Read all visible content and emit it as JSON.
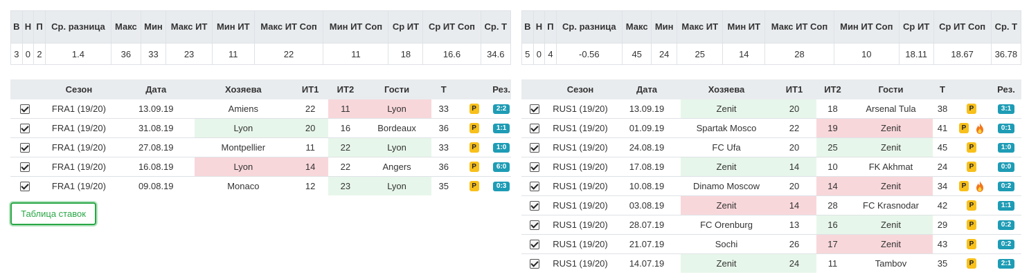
{
  "stats_headers": [
    "В",
    "Н",
    "П",
    "Ср. разница",
    "Макс",
    "Мин",
    "Макс ИТ",
    "Мин ИТ",
    "Макс ИТ Соп",
    "Мин ИТ Соп",
    "Ср ИТ",
    "Ср ИТ Соп",
    "Ср. Т"
  ],
  "left_stats": [
    "3",
    "0",
    "2",
    "1.4",
    "36",
    "33",
    "23",
    "11",
    "22",
    "11",
    "18",
    "16.6",
    "34.6"
  ],
  "right_stats": [
    "5",
    "0",
    "4",
    "-0.56",
    "45",
    "24",
    "25",
    "14",
    "28",
    "10",
    "18.11",
    "18.67",
    "36.78"
  ],
  "games_headers": {
    "season": "Сезон",
    "date": "Дата",
    "home": "Хозяева",
    "it1": "ИТ1",
    "it2": "ИТ2",
    "away": "Гости",
    "total": "Т",
    "result": "Рез."
  },
  "p_badge": "P",
  "colors": {
    "win_bg": "#e7f6ea",
    "loss_bg": "#f8d7da",
    "result_badge": "#1e9cb5",
    "p_badge": "#f7c01b",
    "button": "#28a745"
  },
  "left_games": [
    {
      "season": "FRA1 (19/20)",
      "date": "13.09.19",
      "home": "Amiens",
      "it1": "22",
      "it2": "11",
      "away": "Lyon",
      "total": "33",
      "result": "2:2",
      "fire": false,
      "hl": "away-loss"
    },
    {
      "season": "FRA1 (19/20)",
      "date": "31.08.19",
      "home": "Lyon",
      "it1": "20",
      "it2": "16",
      "away": "Bordeaux",
      "total": "36",
      "result": "1:1",
      "fire": false,
      "hl": "home-win"
    },
    {
      "season": "FRA1 (19/20)",
      "date": "27.08.19",
      "home": "Montpellier",
      "it1": "11",
      "it2": "22",
      "away": "Lyon",
      "total": "33",
      "result": "1:0",
      "fire": false,
      "hl": "away-win"
    },
    {
      "season": "FRA1 (19/20)",
      "date": "16.08.19",
      "home": "Lyon",
      "it1": "14",
      "it2": "22",
      "away": "Angers",
      "total": "36",
      "result": "6:0",
      "fire": false,
      "hl": "home-loss"
    },
    {
      "season": "FRA1 (19/20)",
      "date": "09.08.19",
      "home": "Monaco",
      "it1": "12",
      "it2": "23",
      "away": "Lyon",
      "total": "35",
      "result": "0:3",
      "fire": false,
      "hl": "away-win"
    }
  ],
  "right_games": [
    {
      "season": "RUS1 (19/20)",
      "date": "13.09.19",
      "home": "Zenit",
      "it1": "20",
      "it2": "18",
      "away": "Arsenal Tula",
      "total": "38",
      "result": "3:1",
      "fire": false,
      "hl": "home-win"
    },
    {
      "season": "RUS1 (19/20)",
      "date": "01.09.19",
      "home": "Spartak Mosco",
      "it1": "22",
      "it2": "19",
      "away": "Zenit",
      "total": "41",
      "result": "0:1",
      "fire": true,
      "hl": "away-loss"
    },
    {
      "season": "RUS1 (19/20)",
      "date": "24.08.19",
      "home": "FC Ufa",
      "it1": "20",
      "it2": "25",
      "away": "Zenit",
      "total": "45",
      "result": "1:0",
      "fire": false,
      "hl": "away-win"
    },
    {
      "season": "RUS1 (19/20)",
      "date": "17.08.19",
      "home": "Zenit",
      "it1": "14",
      "it2": "10",
      "away": "FK Akhmat",
      "total": "24",
      "result": "0:0",
      "fire": false,
      "hl": "home-win"
    },
    {
      "season": "RUS1 (19/20)",
      "date": "10.08.19",
      "home": "Dinamo Moscow",
      "it1": "20",
      "it2": "14",
      "away": "Zenit",
      "total": "34",
      "result": "0:2",
      "fire": true,
      "hl": "away-loss"
    },
    {
      "season": "RUS1 (19/20)",
      "date": "03.08.19",
      "home": "Zenit",
      "it1": "14",
      "it2": "28",
      "away": "FC Krasnodar",
      "total": "42",
      "result": "1:1",
      "fire": false,
      "hl": "home-loss"
    },
    {
      "season": "RUS1 (19/20)",
      "date": "28.07.19",
      "home": "FC Orenburg",
      "it1": "13",
      "it2": "16",
      "away": "Zenit",
      "total": "29",
      "result": "0:2",
      "fire": false,
      "hl": "away-win"
    },
    {
      "season": "RUS1 (19/20)",
      "date": "21.07.19",
      "home": "Sochi",
      "it1": "26",
      "it2": "17",
      "away": "Zenit",
      "total": "43",
      "result": "0:2",
      "fire": false,
      "hl": "away-loss"
    },
    {
      "season": "RUS1 (19/20)",
      "date": "14.07.19",
      "home": "Zenit",
      "it1": "24",
      "it2": "11",
      "away": "Tambov",
      "total": "35",
      "result": "2:1",
      "fire": false,
      "hl": "home-win"
    }
  ],
  "bets_button": "Таблица ставок"
}
